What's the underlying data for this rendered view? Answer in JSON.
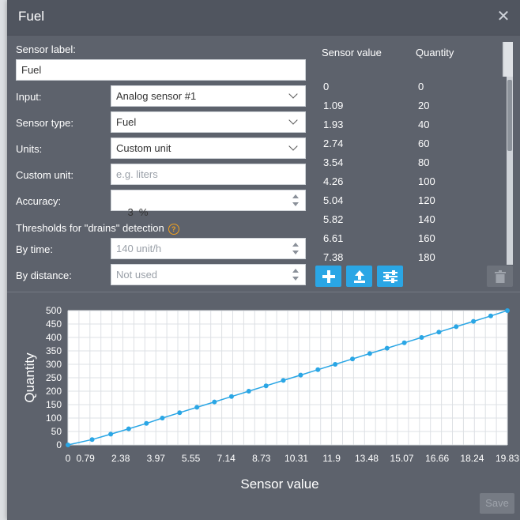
{
  "dialog": {
    "title": "Fuel"
  },
  "form": {
    "sensor_label": {
      "label": "Sensor label:",
      "value": "Fuel"
    },
    "input": {
      "label": "Input:",
      "value": "Analog sensor #1"
    },
    "sensor_type": {
      "label": "Sensor type:",
      "value": "Fuel"
    },
    "units": {
      "label": "Units:",
      "value": "Custom unit"
    },
    "custom_unit": {
      "label": "Custom unit:",
      "placeholder": "e.g. liters"
    },
    "accuracy": {
      "label": "Accuracy:",
      "value": "3  %"
    },
    "thresholds_heading": "Thresholds for \"drains\" detection",
    "by_time": {
      "label": "By time:",
      "placeholder": "140 unit/h"
    },
    "by_distance": {
      "label": "By distance:",
      "placeholder": "Not used"
    }
  },
  "table": {
    "headers": [
      "Sensor value",
      "Quantity"
    ],
    "rows": [
      [
        "0",
        "0"
      ],
      [
        "1.09",
        "20"
      ],
      [
        "1.93",
        "40"
      ],
      [
        "2.74",
        "60"
      ],
      [
        "3.54",
        "80"
      ],
      [
        "4.26",
        "100"
      ],
      [
        "5.04",
        "120"
      ],
      [
        "5.82",
        "140"
      ],
      [
        "6.61",
        "160"
      ],
      [
        "7.38",
        "180"
      ]
    ]
  },
  "buttons": {
    "save": "Save"
  },
  "icons": {
    "add": "plus-icon",
    "upload": "upload-icon",
    "settings": "sliders-icon",
    "delete": "trash-icon",
    "help": "help-icon",
    "close": "close-icon"
  },
  "colors": {
    "accent": "#2aa6e5",
    "panel": "#5d626c",
    "help": "#f0a020"
  },
  "chart_data": {
    "type": "line",
    "xlabel": "Sensor value",
    "ylabel": "Quantity",
    "xlim": [
      0,
      19.83
    ],
    "ylim": [
      0,
      500
    ],
    "x_ticks": [
      "0",
      "0.79",
      "2.38",
      "3.97",
      "5.55",
      "7.14",
      "8.73",
      "10.31",
      "11.9",
      "13.48",
      "15.07",
      "16.66",
      "18.24",
      "19.83"
    ],
    "y_ticks": [
      "0",
      "50",
      "100",
      "150",
      "200",
      "250",
      "300",
      "350",
      "400",
      "450",
      "500"
    ],
    "grid": true,
    "points": {
      "x": [
        0,
        1.09,
        1.93,
        2.74,
        3.54,
        4.26,
        5.04,
        5.82,
        6.61,
        7.38,
        8.16,
        8.94,
        9.72,
        10.5,
        11.28,
        12.06,
        12.84,
        13.62,
        14.4,
        15.18,
        15.96,
        16.74,
        17.52,
        18.3,
        19.08,
        19.83
      ],
      "y": [
        0,
        20,
        40,
        60,
        80,
        100,
        120,
        140,
        160,
        180,
        200,
        220,
        240,
        260,
        280,
        300,
        320,
        340,
        360,
        380,
        400,
        420,
        440,
        460,
        480,
        500
      ]
    }
  }
}
